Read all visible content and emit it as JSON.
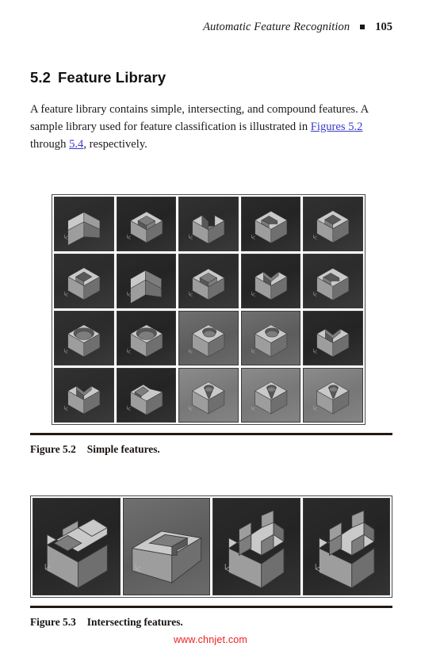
{
  "running_head": {
    "title": "Automatic Feature Recognition",
    "bullet": "square-bullet",
    "page_number": "105"
  },
  "section": {
    "number": "5.2",
    "title": "Feature Library"
  },
  "paragraph": {
    "part1": "A feature library contains simple, intersecting, and compound features. A sample library used for feature classification is illustrated in ",
    "link1": "Figures 5.2",
    "part2": " through ",
    "link2": "5.4",
    "part3": ", respectively."
  },
  "figures": [
    {
      "id": "figure-5-2",
      "caption_number": "Figure 5.2",
      "caption_text": "Simple features.",
      "columns": 5,
      "rows": 4,
      "cells": [
        {
          "name": "step-block",
          "shade": "bg-dark",
          "shape": "step"
        },
        {
          "name": "open-pocket-corner",
          "shade": "bg-darker",
          "shape": "corner-pocket"
        },
        {
          "name": "through-slot",
          "shade": "bg-dark",
          "shape": "slot"
        },
        {
          "name": "blind-slot-round",
          "shade": "bg-darker",
          "shape": "round-slot"
        },
        {
          "name": "square-pocket",
          "shade": "bg-dark",
          "shape": "sq-pocket"
        },
        {
          "name": "square-pocket-2",
          "shade": "bg-dark",
          "shape": "sq-pocket"
        },
        {
          "name": "double-step",
          "shade": "bg-darker",
          "shape": "step2"
        },
        {
          "name": "corner-pocket-2",
          "shade": "bg-dark",
          "shape": "corner-pocket"
        },
        {
          "name": "v-slot",
          "shade": "bg-darker",
          "shape": "vslot"
        },
        {
          "name": "round-end-slot",
          "shade": "bg-dark",
          "shape": "round-slot"
        },
        {
          "name": "oblong-pocket",
          "shade": "bg-dark",
          "shape": "oblong"
        },
        {
          "name": "rounded-pocket",
          "shade": "bg-darker",
          "shape": "oblong"
        },
        {
          "name": "through-hole",
          "shade": "bg-mid",
          "shape": "hole"
        },
        {
          "name": "counterbore-hole",
          "shade": "bg-mid",
          "shape": "hole"
        },
        {
          "name": "angled-slot",
          "shade": "bg-darker",
          "shape": "vslot"
        },
        {
          "name": "v-groove",
          "shade": "bg-dark",
          "shape": "vslot"
        },
        {
          "name": "chamfer-slot",
          "shade": "bg-darker",
          "shape": "chamfer"
        },
        {
          "name": "countersink-hole",
          "shade": "bg-light",
          "shape": "csink"
        },
        {
          "name": "counterdrill-hole",
          "shade": "bg-light",
          "shape": "csink"
        },
        {
          "name": "tapered-hole",
          "shade": "bg-light",
          "shape": "csink"
        }
      ]
    },
    {
      "id": "figure-5-3",
      "caption_number": "Figure 5.3",
      "caption_text": "Intersecting features.",
      "columns": 4,
      "rows": 1,
      "cells": [
        {
          "name": "multi-parallel-slots",
          "shade": "bg-darker",
          "shape": "ribs"
        },
        {
          "name": "long-tee-slot",
          "shade": "bg-mid",
          "shape": "longslot"
        },
        {
          "name": "cross-slots-block",
          "shade": "bg-darker",
          "shape": "cross"
        },
        {
          "name": "cross-slots-block-2",
          "shade": "bg-darker",
          "shape": "cross"
        }
      ]
    }
  ],
  "watermark": "www.chnjet.com"
}
